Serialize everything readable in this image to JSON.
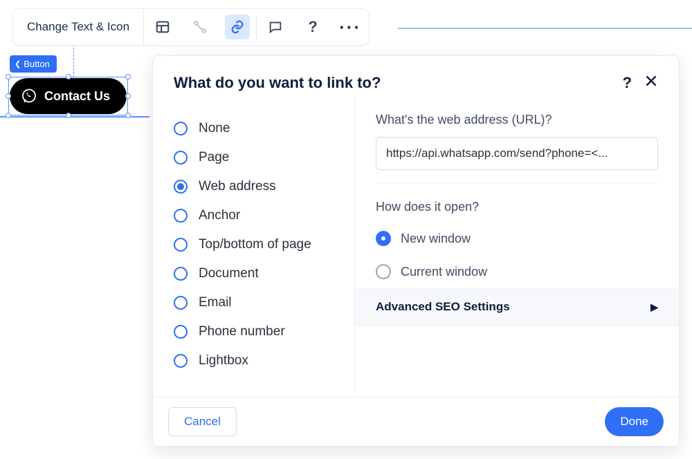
{
  "toolbar": {
    "change_text_label": "Change Text & Icon"
  },
  "tag": {
    "button_label": "Button"
  },
  "pill": {
    "text": "Contact Us"
  },
  "dialog": {
    "title": "What do you want to link to?",
    "link_types": {
      "none": "None",
      "page": "Page",
      "web_address": "Web address",
      "anchor": "Anchor",
      "top_bottom": "Top/bottom of page",
      "document": "Document",
      "email": "Email",
      "phone": "Phone number",
      "lightbox": "Lightbox",
      "selected": "web_address"
    },
    "url_label": "What's the web address (URL)?",
    "url_value": "https://api.whatsapp.com/send?phone=<...",
    "open_label": "How does it open?",
    "open_options": {
      "new_window": "New window",
      "current_window": "Current window",
      "selected": "new_window"
    },
    "seo_label": "Advanced SEO Settings",
    "cancel": "Cancel",
    "done": "Done"
  }
}
